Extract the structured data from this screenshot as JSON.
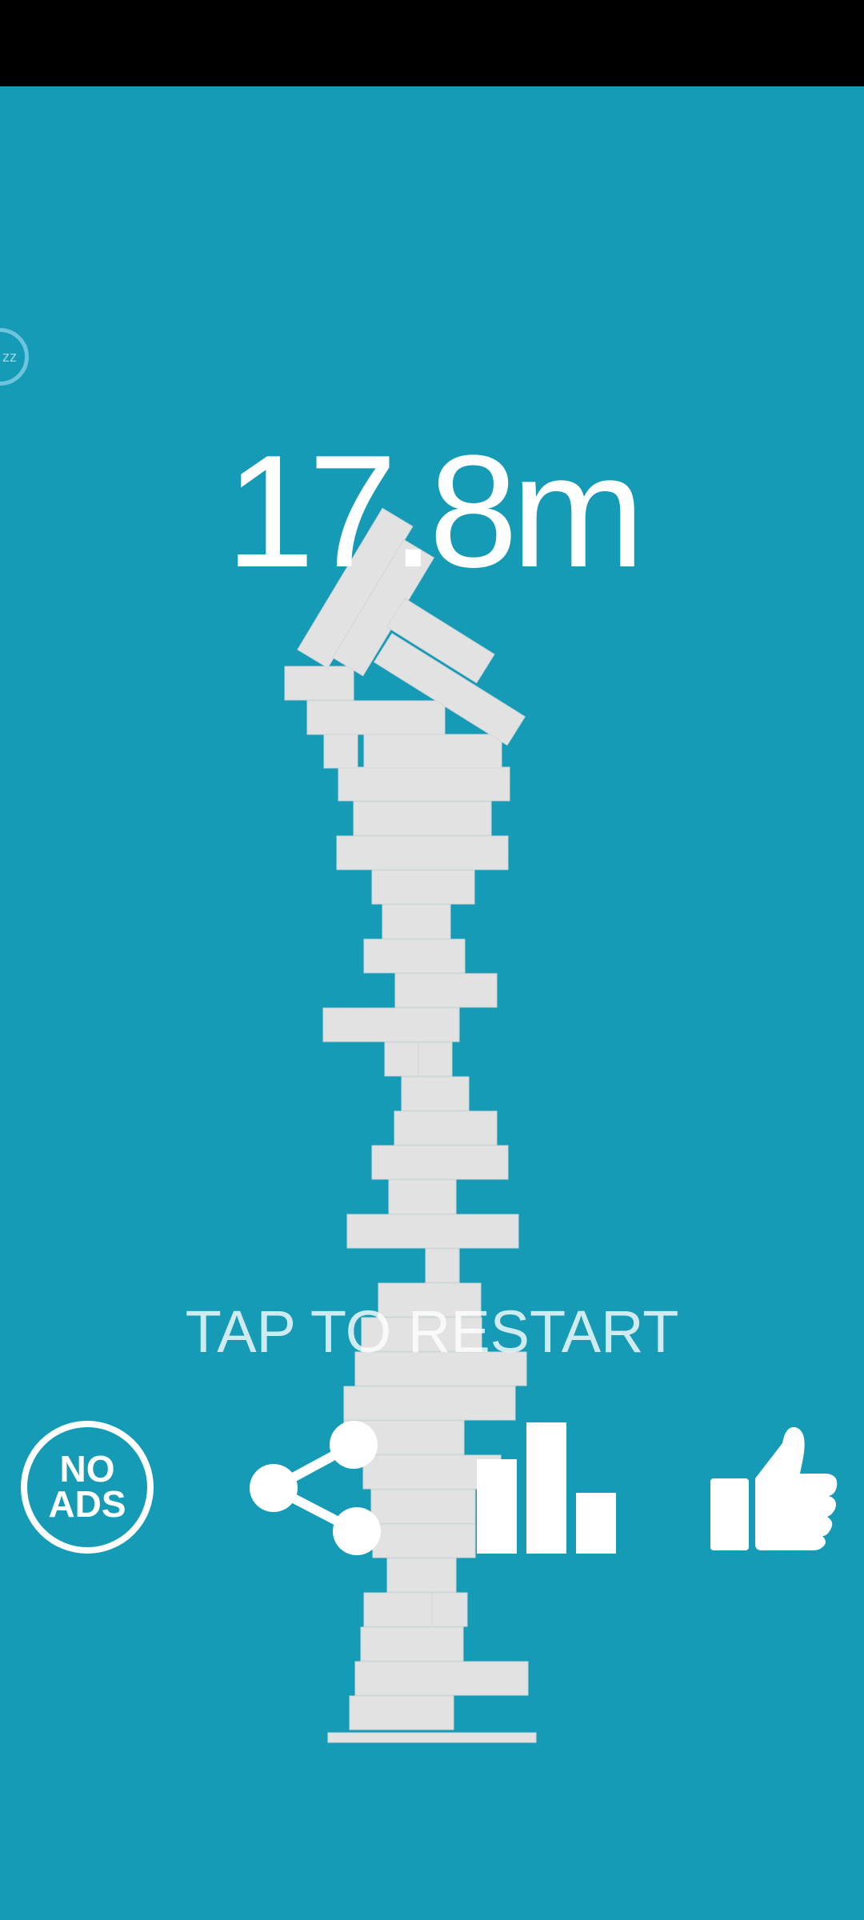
{
  "game": {
    "score": "17.8m",
    "restart_prompt": "TAP TO RESTART",
    "sleep_badge": "zz"
  },
  "buttons": {
    "no_ads_line1": "NO",
    "no_ads_line2": "ADS",
    "share_icon": "share-icon",
    "leaderboard_icon": "bar-chart-icon",
    "rate_icon": "thumbs-up-icon"
  },
  "colors": {
    "background": "#159bb5",
    "block": "#e2e2e2",
    "text": "#ffffff"
  }
}
